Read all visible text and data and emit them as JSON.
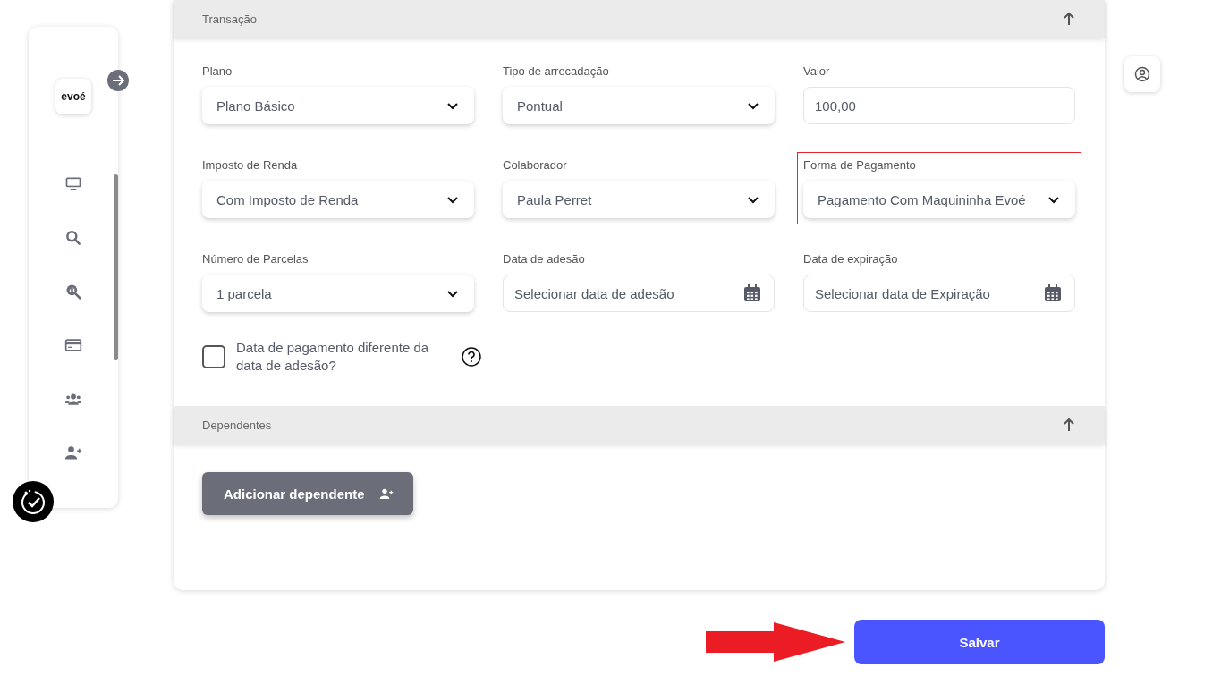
{
  "sidebar": {
    "logo": "evoé"
  },
  "sections": [
    {
      "title": "Transação",
      "expanded": true,
      "fields": [
        {
          "kind": "select",
          "label": "Plano",
          "value": "Plano Básico",
          "highlighted": false
        },
        {
          "kind": "select",
          "label": "Tipo de arrecadação",
          "value": "Pontual",
          "highlighted": false
        },
        {
          "kind": "input",
          "label": "Valor",
          "value": "100,00",
          "highlighted": false
        },
        {
          "kind": "select",
          "label": "Imposto de Renda",
          "value": "Com Imposto de Renda",
          "highlighted": false
        },
        {
          "kind": "select",
          "label": "Colaborador",
          "value": "Paula Perret",
          "highlighted": false
        },
        {
          "kind": "select",
          "label": "Forma de Pagamento",
          "value": "Pagamento Com Maquininha Evoé",
          "highlighted": true
        },
        {
          "kind": "select",
          "label": "Número de Parcelas",
          "value": "1 parcela",
          "highlighted": false
        },
        {
          "kind": "date",
          "label": "Data de adesão",
          "placeholder": "Selecionar data de adesão",
          "highlighted": false
        },
        {
          "kind": "date",
          "label": "Data de expiração",
          "placeholder": "Selecionar data de Expiração",
          "highlighted": false
        }
      ],
      "checkbox": {
        "label": "Data de pagamento diferente da data de adesão?",
        "checked": false
      }
    },
    {
      "title": "Dependentes",
      "expanded": true,
      "button": "Adicionar dependente"
    }
  ],
  "save_button": "Salvar"
}
